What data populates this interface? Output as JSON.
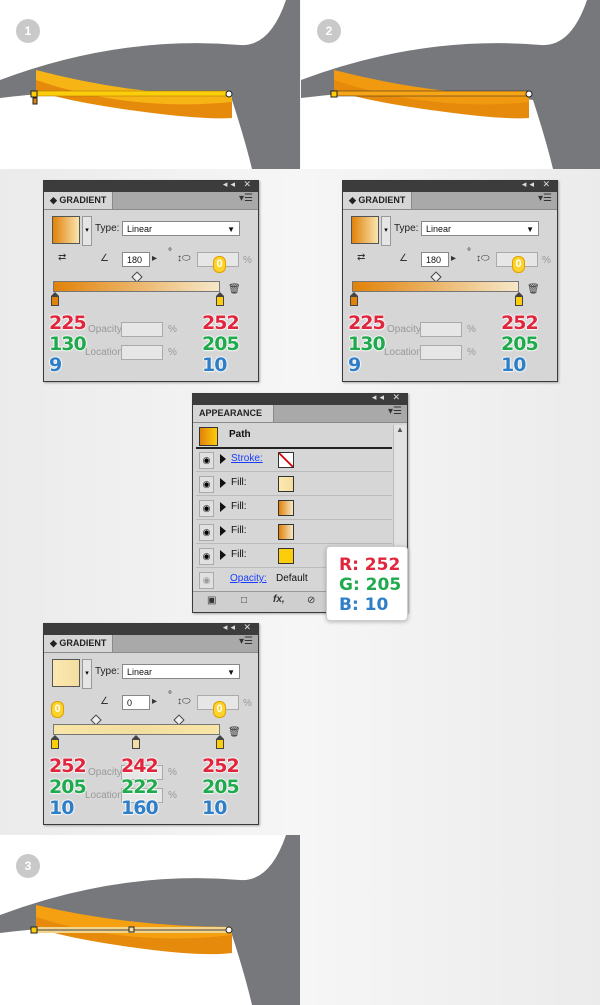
{
  "steps": [
    {
      "number": "1"
    },
    {
      "number": "2"
    },
    {
      "number": "3"
    }
  ],
  "gradient_panel": {
    "title": "GRADIENT",
    "type_label": "Type:",
    "type_value": "Linear",
    "degree_sign": "°",
    "percent": "%",
    "opacity_label": "Opacity:",
    "location_label": "Location:"
  },
  "panel_a": {
    "angle": "180",
    "ratio": "0",
    "stops": [
      {
        "r": "225",
        "g": "130",
        "b": "9"
      },
      {
        "r": "252",
        "g": "205",
        "b": "10"
      }
    ]
  },
  "panel_b": {
    "angle": "180",
    "ratio": "0",
    "stops": [
      {
        "r": "225",
        "g": "130",
        "b": "9"
      },
      {
        "r": "252",
        "g": "205",
        "b": "10"
      }
    ]
  },
  "panel_c": {
    "angle": "0",
    "ratio": "0",
    "left_badge": "0",
    "stops": [
      {
        "r": "252",
        "g": "205",
        "b": "10"
      },
      {
        "r": "242",
        "g": "222",
        "b": "160"
      },
      {
        "r": "252",
        "g": "205",
        "b": "10"
      }
    ]
  },
  "appearance": {
    "title": "APPEARANCE",
    "path_label": "Path",
    "rows": [
      {
        "label": "Stroke:"
      },
      {
        "label": "Fill:"
      },
      {
        "label": "Fill:"
      },
      {
        "label": "Fill:"
      },
      {
        "label": "Fill:"
      }
    ],
    "opacity_label": "Opacity:",
    "opacity_value": "Default"
  },
  "tooltip": {
    "r": "R: 252",
    "g": "G: 205",
    "b": "B: 10"
  },
  "colors": {
    "orange": "#E18209",
    "yellow": "#FCCD0A",
    "cream": "#F2DEA0",
    "gray": "#7a7a7a"
  }
}
